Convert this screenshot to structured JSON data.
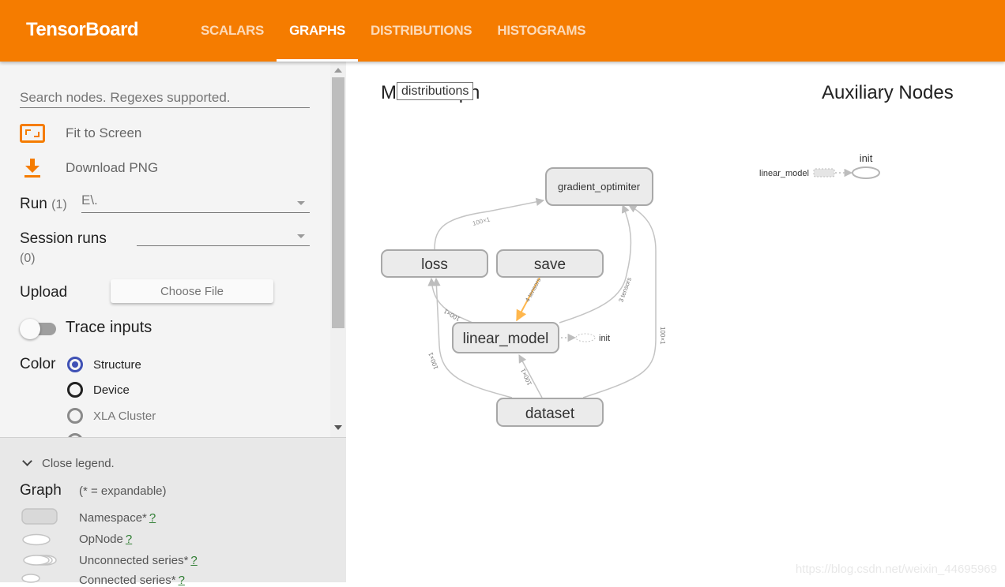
{
  "header": {
    "brand": "TensorBoard",
    "tabs": [
      {
        "label": "SCALARS",
        "active": false
      },
      {
        "label": "GRAPHS",
        "active": true
      },
      {
        "label": "DISTRIBUTIONS",
        "active": false
      },
      {
        "label": "HISTOGRAMS",
        "active": false
      }
    ],
    "colors": {
      "brand": "#f57c00"
    }
  },
  "sidebar": {
    "search_placeholder": "Search nodes. Regexes supported.",
    "fit_label": "Fit to Screen",
    "download_label": "Download PNG",
    "run_label": "Run",
    "run_count": "(1)",
    "run_value": "E\\.",
    "session_label": "Session runs",
    "session_count": "(0)",
    "session_value": "",
    "upload_label": "Upload",
    "choose_file": "Choose File",
    "trace_label": "Trace inputs",
    "trace_on": false,
    "color_label": "Color",
    "color_options": [
      {
        "label": "Structure",
        "selected": true
      },
      {
        "label": "Device",
        "selected": false
      },
      {
        "label": "XLA Cluster",
        "selected": false
      }
    ]
  },
  "legend": {
    "close_label": "Close legend.",
    "graph_title": "Graph",
    "graph_note": "(* = expandable)",
    "items": [
      {
        "label": "Namespace*",
        "help": "?"
      },
      {
        "label": "OpNode",
        "help": "?"
      },
      {
        "label": "Unconnected series*",
        "help": "?"
      },
      {
        "label": "Connected series*",
        "help": "?"
      }
    ]
  },
  "main": {
    "title": "Main Graph",
    "tooltip": "distributions",
    "aux_title": "Auxiliary Nodes",
    "nodes": {
      "gradient_optimiter": "gradient_optimiter",
      "loss": "loss",
      "save": "save",
      "linear_model": "linear_model",
      "dataset": "dataset",
      "init": "init"
    },
    "edge_labels": {
      "loss_to_grad": "100×1",
      "save_to_linear": "4 tensors",
      "linear_to_grad": "3 tensors",
      "dataset_to_grad": "100×1",
      "linear_to_loss": "100×1",
      "dataset_to_loss": "100×1",
      "dataset_to_linear": "100×1"
    },
    "aux": {
      "source": "linear_model",
      "target": "init"
    },
    "colors": {
      "ref_edge": "#ffb74d",
      "node_fill": "#ebebeb",
      "node_stroke": "#a8a8a8"
    }
  },
  "watermark": "https://blog.csdn.net/weixin_44695969"
}
